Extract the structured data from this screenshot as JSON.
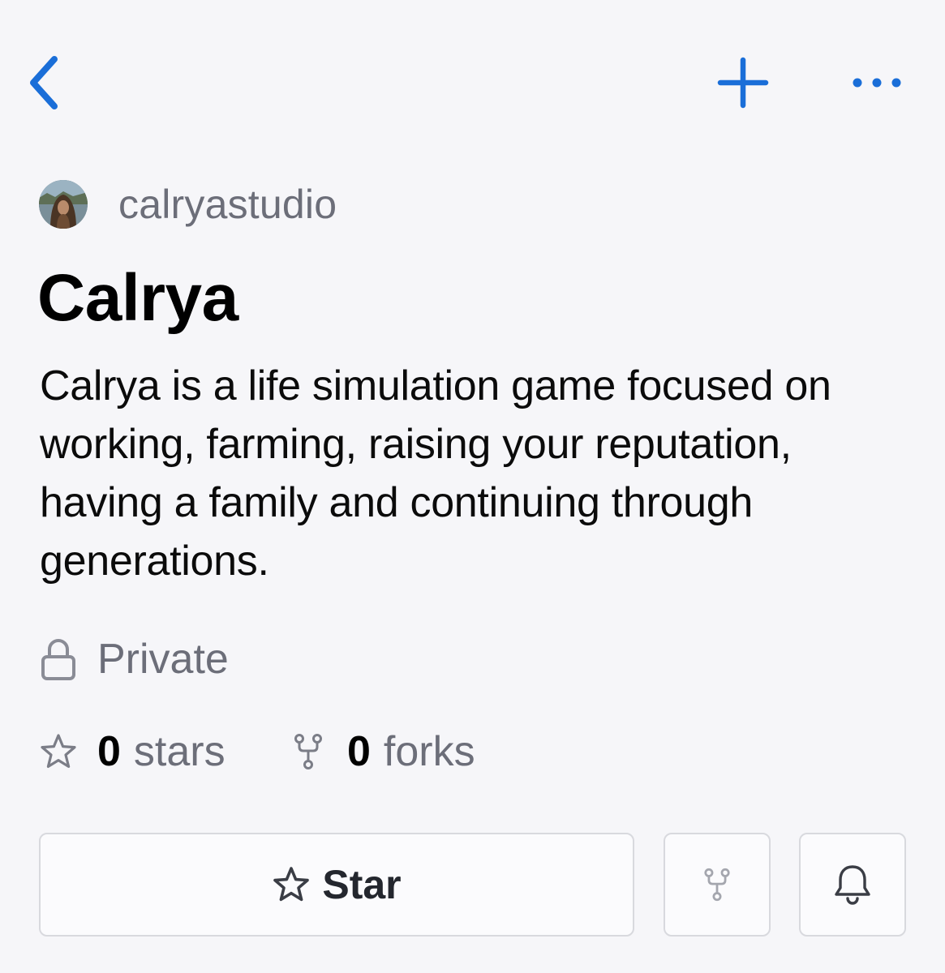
{
  "nav": {
    "back_icon": "chevron-left-icon",
    "add_icon": "plus-icon",
    "more_icon": "ellipsis-icon",
    "accent_color": "#1a6ed8"
  },
  "repo": {
    "owner": "calryastudio",
    "name": "Calrya",
    "description": "Calrya is a life simulation game focused on working, farming, raising your reputation, having a family and continuing through generations.",
    "visibility": "Private",
    "stars": {
      "count": "0",
      "label": "stars"
    },
    "forks": {
      "count": "0",
      "label": "forks"
    }
  },
  "actions": {
    "star_label": "Star",
    "star_icon": "star-icon",
    "fork_icon": "fork-icon",
    "watch_icon": "bell-icon"
  }
}
